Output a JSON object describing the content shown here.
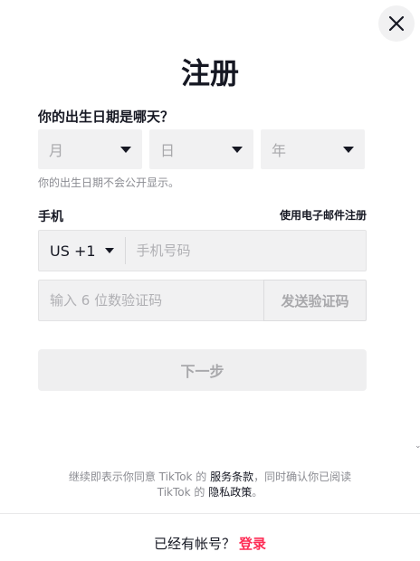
{
  "title": "注册",
  "dob": {
    "label": "你的出生日期是哪天？",
    "month_placeholder": "月",
    "day_placeholder": "日",
    "year_placeholder": "年",
    "hint": "你的出生日期不会公开显示。"
  },
  "phone": {
    "label": "手机",
    "email_link": "使用电子邮件注册",
    "country_code": "US +1",
    "phone_placeholder": "手机号码",
    "code_placeholder": "输入 6 位数验证码",
    "send_code_label": "发送验证码"
  },
  "next_label": "下一步",
  "terms": {
    "prefix": "继续即表示你同意 TikTok 的 ",
    "terms_link": "服务条款",
    "middle": "，同时确认你已阅读",
    "line2_prefix": "TikTok 的 ",
    "privacy_link": "隐私政策",
    "suffix": "。"
  },
  "footer": {
    "prompt": "已经有帐号？",
    "login_label": "登录"
  },
  "colors": {
    "accent": "#fe2c55",
    "field_bg": "#f1f1f2",
    "text": "#161823"
  },
  "icons": {
    "close": "close-icon",
    "dropdown": "caret-down-icon"
  }
}
